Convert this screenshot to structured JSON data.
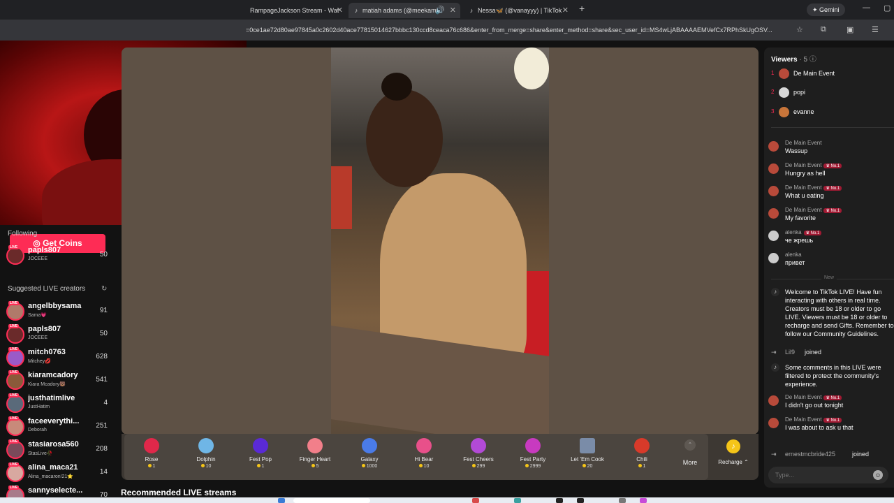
{
  "browser": {
    "tabs": [
      {
        "label": "RampageJackson Stream - Wat",
        "active": false,
        "icon": "rampage-favicon"
      },
      {
        "label": "matiah adams (@meekamil",
        "active": true,
        "icon": "tiktok-icon",
        "audio": true
      },
      {
        "label": "Nessa🦋 (@vanayyy) | TikTok",
        "active": false,
        "icon": "tiktok-icon"
      }
    ],
    "new_tab": "+",
    "gemini_label": "Gemini",
    "url": "=0ce1ae72d80ae97845a0c2602d40ace77815014627bbbc130ccd8ceaca76c686&enter_from_merge=share&enter_method=share&sec_user_id=MS4wLjABAAAAEMVefCx7RPhSkUgOSV..."
  },
  "sidebar": {
    "get_coins_label": "Get Coins",
    "following_label": "Following",
    "following": [
      {
        "name": "papls807",
        "sub": "JOCEEE",
        "count": "50"
      }
    ],
    "suggested_label": "Suggested LIVE creators",
    "suggested": [
      {
        "name": "angelbbysama",
        "sub": "Sama💗",
        "count": "91"
      },
      {
        "name": "papls807",
        "sub": "JOCEEE",
        "count": "50"
      },
      {
        "name": "mitch0763",
        "sub": "Mitchey💋",
        "count": "628"
      },
      {
        "name": "kiaramcadory",
        "sub": "Kiara Mcadory🐻",
        "count": "541"
      },
      {
        "name": "justhatimlive",
        "sub": "JustHatim",
        "count": "4"
      },
      {
        "name": "faceeverythi...",
        "sub": "Deborah",
        "count": "251"
      },
      {
        "name": "stasiarosa560",
        "sub": "StasLive🥀",
        "count": "208"
      },
      {
        "name": "alina_maca21",
        "sub": "Alina_macaron!21⭐",
        "count": "14"
      },
      {
        "name": "sannyselecte...",
        "sub": "",
        "count": "70"
      }
    ]
  },
  "gifts": [
    {
      "name": "Rose",
      "price": "1",
      "color": "#e0284a"
    },
    {
      "name": "Dolphin",
      "price": "10",
      "color": "#6fb6e6"
    },
    {
      "name": "Fest Pop",
      "price": "1",
      "color": "#5a2ad6"
    },
    {
      "name": "Finger Heart",
      "price": "5",
      "color": "#f27f8a"
    },
    {
      "name": "Galaxy",
      "price": "1000",
      "color": "#4a7be8"
    },
    {
      "name": "Hi Bear",
      "price": "10",
      "color": "#e8508a"
    },
    {
      "name": "Fest Cheers",
      "price": "299",
      "color": "#b24ad6"
    },
    {
      "name": "Fest Party",
      "price": "2999",
      "color": "#c83ac0"
    },
    {
      "name": "Let 'Em Cook",
      "price": "20",
      "color": "#7a8ca8"
    },
    {
      "name": "Chili",
      "price": "1",
      "color": "#d83a2a"
    }
  ],
  "more_label": "More",
  "recharge_label": "Recharge ⌃",
  "recommended_label": "Recommended LIVE streams",
  "viewers": {
    "title": "Viewers",
    "count": "5",
    "list": [
      {
        "rank": "1",
        "name": "De Main Event",
        "color": "#b84a3a"
      },
      {
        "rank": "2",
        "name": "popi",
        "color": "#d8d8d8"
      },
      {
        "rank": "3",
        "name": "evanne",
        "color": "#c8753a"
      }
    ]
  },
  "chat": [
    {
      "user": "De Main Event",
      "badge": "",
      "text": "Wassup"
    },
    {
      "user": "De Main Event",
      "badge": "No.1",
      "text": "Hungry as hell"
    },
    {
      "user": "De Main Event",
      "badge": "No.1",
      "text": "What u eating"
    },
    {
      "user": "De Main Event",
      "badge": "No.1",
      "text": "My favorite"
    },
    {
      "user": "alenka",
      "badge": "No.1",
      "text": "че жрешь"
    },
    {
      "user": "alenka",
      "badge": "",
      "text": "привет"
    }
  ],
  "new_label": "New",
  "system_welcome": "Welcome to TikTok LIVE! Have fun\ninteracting with others in real time.\nCreators must be 18 or older to go\nLIVE. Viewers must be 18 or older to\nrecharge and send Gifts. Remember to\nfollow our Community Guidelines.",
  "join1": {
    "name": "Lil9",
    "action": "joined"
  },
  "system_filtered": "Some comments in this LIVE were\nfiltered to protect the community's\nexperience.",
  "chat2": [
    {
      "user": "De Main Event",
      "badge": "No.1",
      "text": "I didn't go out tonight"
    },
    {
      "user": "De Main Event",
      "badge": "No.1",
      "text": "I was about to ask u that"
    }
  ],
  "join2": {
    "name": "ernestmcbride425",
    "action": "joined"
  },
  "type_placeholder": "Type..."
}
